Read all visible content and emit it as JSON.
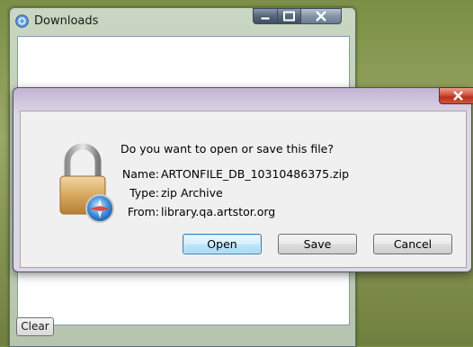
{
  "downloads_window": {
    "title": "Downloads",
    "clear_label": "Clear"
  },
  "dialog": {
    "question": "Do you want to open or save this file?",
    "name_label": "Name:",
    "name_value": "ARTONFILE_DB_10310486375.zip",
    "type_label": "Type:",
    "type_value": "zip Archive",
    "from_label": "From:",
    "from_value": "library.qa.artstor.org",
    "buttons": {
      "open": "Open",
      "save": "Save",
      "cancel": "Cancel"
    }
  },
  "icons": {
    "app": "downloads-globe-icon",
    "lock": "padlock-safari-icon",
    "min": "minimize-icon",
    "max": "maximize-icon",
    "close": "close-icon"
  },
  "colors": {
    "close_red": "#c8402a",
    "default_button_border": "#3c7fb1",
    "dialog_title_tint": "#c4b3d4"
  }
}
